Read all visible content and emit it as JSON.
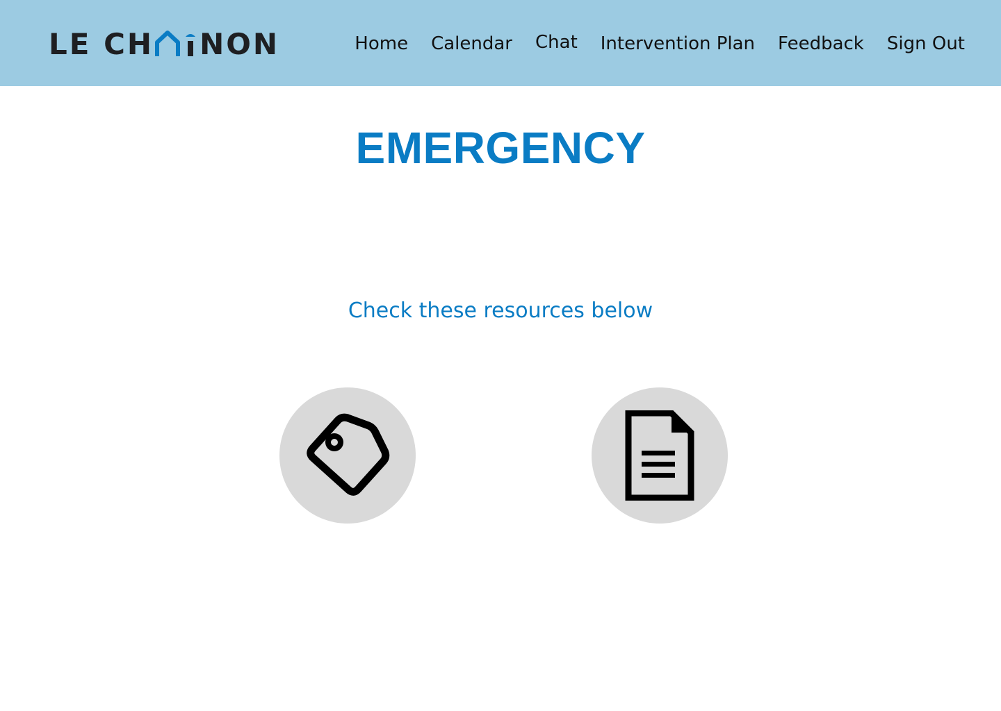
{
  "header": {
    "logo": {
      "part1": "LE CH",
      "part2": "NON",
      "accent_color": "#0a7cc4"
    },
    "nav": [
      {
        "label": "Home"
      },
      {
        "label": "Calendar"
      },
      {
        "label": "Chat"
      },
      {
        "label": "Intervention Plan"
      },
      {
        "label": "Feedback"
      },
      {
        "label": "Sign Out"
      }
    ],
    "background_color": "#9ccbe2"
  },
  "main": {
    "title": "EMERGENCY",
    "subtitle": "Check these resources below",
    "resources": [
      {
        "icon": "tag-icon"
      },
      {
        "icon": "document-icon"
      }
    ]
  }
}
